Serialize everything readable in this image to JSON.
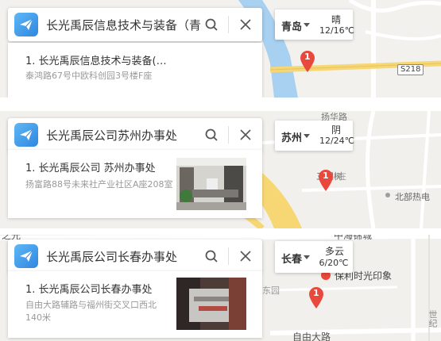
{
  "colors": {
    "accent": "#2f86e0",
    "marker": "#e8493c",
    "road_yellow": "#f7d774",
    "water": "#a8d0f0"
  },
  "panels": [
    {
      "search": {
        "query": "长光禹辰信息技术与装备（青岛）"
      },
      "result": {
        "title": "1. 长光禹辰信息技术与装备(…",
        "address": "泰鸿路67号中欧科创园3号楼F座"
      },
      "weather": {
        "city": "青岛",
        "condition": "晴",
        "temp": "12/16℃"
      },
      "marker": {
        "label": "1"
      },
      "map_labels": {
        "road": "S218"
      }
    },
    {
      "search": {
        "query": "长光禹辰公司苏州办事处"
      },
      "result": {
        "title": "1. 长光禹辰公司 苏州办事处",
        "address": "扬富路88号未来社产业社区A座208室"
      },
      "weather": {
        "city": "苏州",
        "condition": "阴",
        "temp": "12/24℃"
      },
      "marker": {
        "label": "1"
      },
      "map_labels": {
        "a": "扬华路",
        "b": "三棵树",
        "c": "北部热电",
        "d": "在"
      }
    },
    {
      "search": {
        "query": "长光禹辰公司长春办事处"
      },
      "result": {
        "title": "1. 长光禹辰公司长春办事处",
        "address": "自由大路辅路与福州街交叉口西北140米"
      },
      "weather": {
        "city": "长春",
        "condition": "多云",
        "temp": "6/20℃"
      },
      "marker": {
        "label": "1"
      },
      "map_labels": {
        "a": "中海锦城",
        "b": "保利时光印象",
        "c": "东园",
        "d": "自由大路",
        "e": "世纪",
        "f": "之光"
      }
    }
  ]
}
